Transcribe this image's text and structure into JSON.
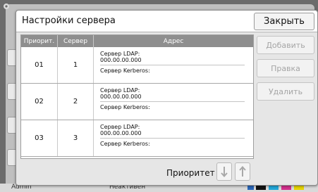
{
  "dialog": {
    "title": "Настройки сервера",
    "close_label": "Закрыть"
  },
  "table": {
    "headers": [
      "Приорит.",
      "Сервер",
      "Адрес"
    ],
    "rows": [
      {
        "priority": "01",
        "server": "1",
        "ldap_label": "Сервер LDAP:",
        "ldap_value": "000.00.00.000",
        "kerberos_label": "Сервер Kerberos:"
      },
      {
        "priority": "02",
        "server": "2",
        "ldap_label": "Сервер LDAP:",
        "ldap_value": "000.00.00.000",
        "kerberos_label": "Сервер Kerberos:"
      },
      {
        "priority": "03",
        "server": "3",
        "ldap_label": "Сервер LDAP:",
        "ldap_value": "000.00.00.000",
        "kerberos_label": "Сервер Kerberos:"
      }
    ]
  },
  "side_buttons": {
    "add": "Добавить",
    "edit": "Правка",
    "delete": "Удалить"
  },
  "priority": {
    "label": "Приоритет",
    "down_icon": "arrow-down-icon",
    "up_icon": "arrow-up-icon"
  },
  "status_bar": {
    "user": "Admin",
    "state": "Неактивен"
  },
  "colors": {
    "header_bg": "#8e8e8e",
    "dialog_bg": "#e6e6e6",
    "disabled_text": "#a5a5a5"
  }
}
